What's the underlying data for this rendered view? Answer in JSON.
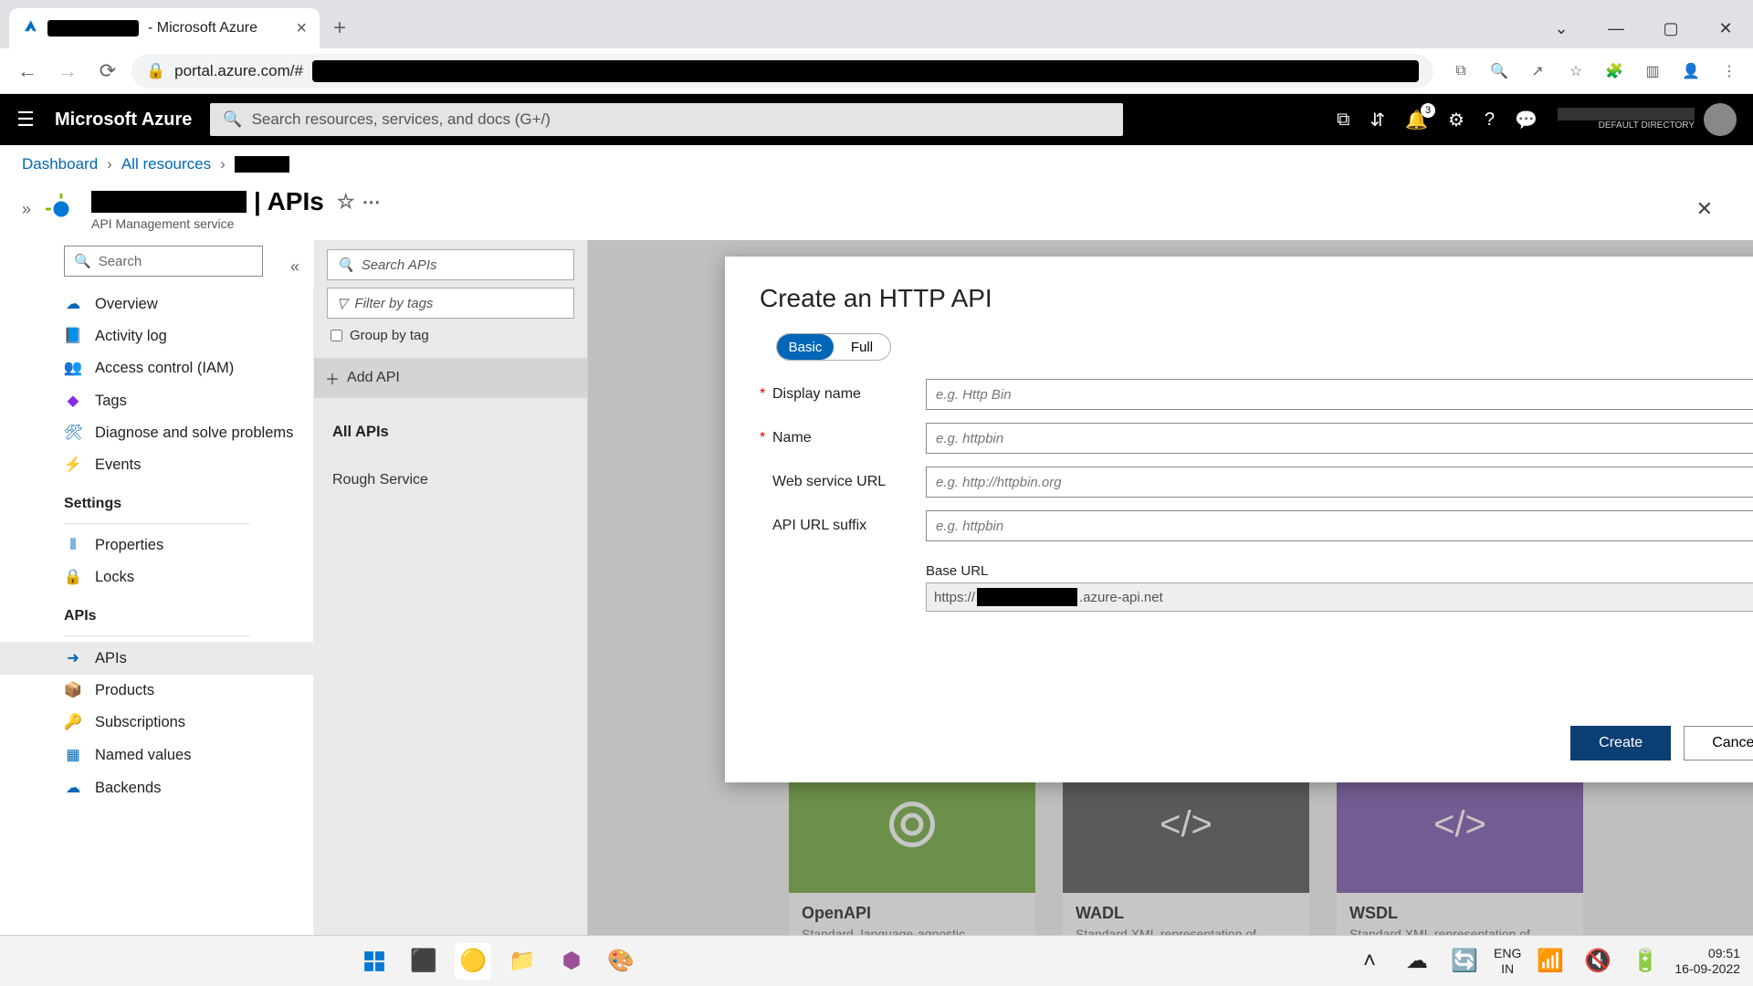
{
  "browser": {
    "tab_title_suffix": " - Microsoft Azure",
    "url_prefix": "portal.azure.com/#"
  },
  "azure_header": {
    "logo": "Microsoft Azure",
    "search_placeholder": "Search resources, services, and docs (G+/)",
    "notification_count": "3",
    "directory_line": "DEFAULT DIRECTORY"
  },
  "breadcrumb": {
    "dashboard": "Dashboard",
    "all_resources": "All resources"
  },
  "page": {
    "title_suffix": " | APIs",
    "subtitle": "API Management service"
  },
  "side_search_placeholder": "Search",
  "sidebar": {
    "overview": "Overview",
    "activity_log": "Activity log",
    "access_control": "Access control (IAM)",
    "tags": "Tags",
    "diagnose": "Diagnose and solve problems",
    "events": "Events",
    "settings_header": "Settings",
    "properties": "Properties",
    "locks": "Locks",
    "apis_header": "APIs",
    "apis": "APIs",
    "products": "Products",
    "subscriptions": "Subscriptions",
    "named_values": "Named values",
    "backends": "Backends"
  },
  "api_col": {
    "search_placeholder": "Search APIs",
    "filter_placeholder": "Filter by tags",
    "group_by_tag": "Group by tag",
    "add_api": "Add API",
    "all_apis": "All APIs",
    "item1": "Rough Service"
  },
  "cards": {
    "openapi": {
      "title": "OpenAPI",
      "desc": "Standard, language-agnostic"
    },
    "wadl": {
      "title": "WADL",
      "desc": "Standard XML representation of"
    },
    "wsdl": {
      "title": "WSDL",
      "desc": "Standard XML representation of"
    }
  },
  "modal": {
    "title": "Create an HTTP API",
    "mode_basic": "Basic",
    "mode_full": "Full",
    "labels": {
      "display_name": "Display name",
      "name": "Name",
      "web_service_url": "Web service URL",
      "api_url_suffix": "API URL suffix",
      "base_url": "Base URL"
    },
    "placeholders": {
      "display_name": "e.g. Http Bin",
      "name": "e.g. httpbin",
      "web_service_url": "e.g. http://httpbin.org",
      "api_url_suffix": "e.g. httpbin"
    },
    "base_url_prefix": "https://",
    "base_url_suffix": ".azure-api.net",
    "create": "Create",
    "cancel": "Cancel"
  },
  "taskbar": {
    "lang1": "ENG",
    "lang2": "IN",
    "time": "09:51",
    "date": "16-09-2022"
  }
}
